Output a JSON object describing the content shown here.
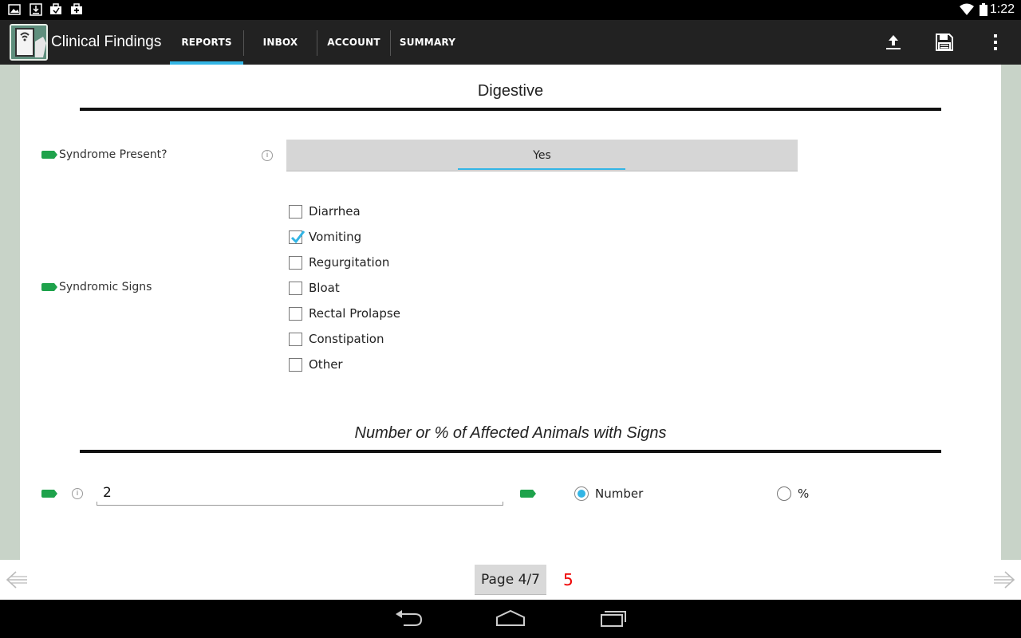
{
  "status_bar": {
    "time": "1:22",
    "icons": [
      "picture-icon",
      "download-icon",
      "briefcase-icon",
      "briefcase-plus-icon",
      "wifi-icon",
      "battery-icon"
    ]
  },
  "action_bar": {
    "app_title": "Clinical Findings",
    "tabs": [
      {
        "label": "REPORTS",
        "active": true
      },
      {
        "label": "INBOX",
        "active": false
      },
      {
        "label": "ACCOUNT",
        "active": false
      },
      {
        "label": "SUMMARY",
        "active": false
      }
    ],
    "actions": [
      "upload-icon",
      "save-icon",
      "overflow-menu-icon"
    ],
    "accent_color": "#33b5e5"
  },
  "form": {
    "section_title": "Digestive",
    "syndrome_present": {
      "label": "Syndrome Present?",
      "info": "i",
      "value": "Yes"
    },
    "syndromic_signs": {
      "label": "Syndromic Signs",
      "options": [
        {
          "label": "Diarrhea",
          "checked": false
        },
        {
          "label": "Vomiting",
          "checked": true
        },
        {
          "label": "Regurgitation",
          "checked": false
        },
        {
          "label": "Bloat",
          "checked": false
        },
        {
          "label": "Rectal Prolapse",
          "checked": false
        },
        {
          "label": "Constipation",
          "checked": false
        },
        {
          "label": "Other",
          "checked": false
        }
      ]
    },
    "affected_section_title": "Number or % of Affected Animals with Signs",
    "affected": {
      "info": "i",
      "value": "2",
      "unit_options": [
        {
          "label": "Number",
          "selected": true
        },
        {
          "label": "%",
          "selected": false
        }
      ]
    },
    "tag_color": "#1ea24b"
  },
  "paging": {
    "page_label": "Page 4/7",
    "count": "5",
    "count_color": "#ee0000"
  }
}
